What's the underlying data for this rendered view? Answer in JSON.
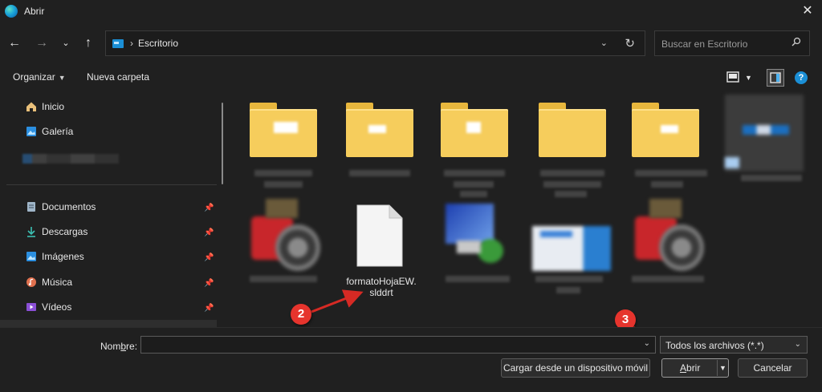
{
  "window": {
    "title": "Abrir"
  },
  "address_bar": {
    "separator": "›",
    "path": "Escritorio"
  },
  "search": {
    "placeholder": "Buscar en Escritorio"
  },
  "toolbar": {
    "organize_label": "Organizar",
    "new_folder_label": "Nueva carpeta"
  },
  "sidebar": {
    "top_items": [
      {
        "label": "Inicio",
        "icon": "home-icon"
      },
      {
        "label": "Galería",
        "icon": "gallery-icon"
      }
    ],
    "pinned_items": [
      {
        "label": "Documentos",
        "icon": "documents-icon"
      },
      {
        "label": "Descargas",
        "icon": "downloads-icon"
      },
      {
        "label": "Imágenes",
        "icon": "pictures-icon"
      },
      {
        "label": "Música",
        "icon": "music-icon"
      },
      {
        "label": "Vídeos",
        "icon": "videos-icon"
      }
    ]
  },
  "content": {
    "visible_file": {
      "name_line1": "formatoHojaEW.",
      "name_line2": "slddrt",
      "icon": "blank-file-icon"
    }
  },
  "annotations": {
    "badge_2": "2",
    "badge_3": "3",
    "badge_color": "#e6342d"
  },
  "bottom": {
    "name_label_prefix": "Nom",
    "name_label_accel": "b",
    "name_label_suffix": "re:",
    "name_value": "",
    "file_type": "Todos los archivos (*.*)",
    "load_mobile_button": "Cargar desde un dispositivo móvil",
    "open_button_accel": "A",
    "open_button_rest": "brir",
    "cancel_button": "Cancelar"
  },
  "colors": {
    "accent": "#1b8fd6",
    "folder": "#f6cd5c",
    "background": "#202020"
  }
}
